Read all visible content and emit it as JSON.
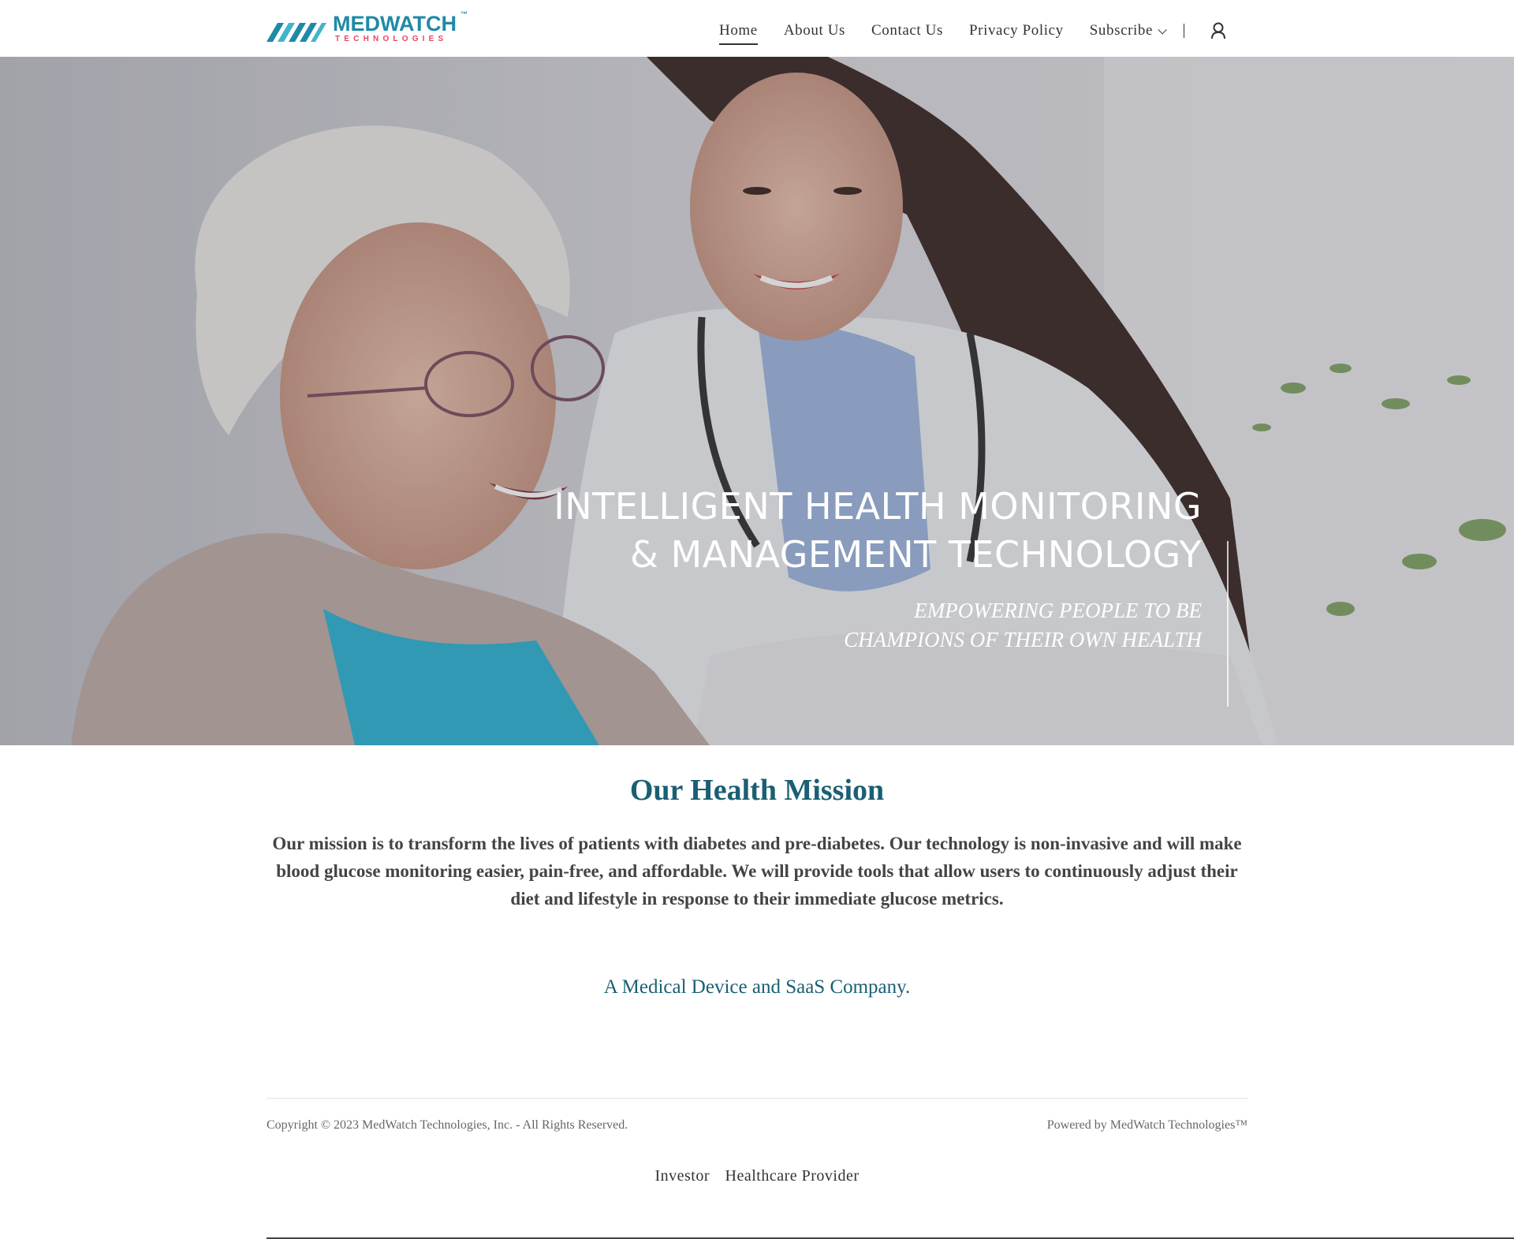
{
  "brand": {
    "name_part1": "MED",
    "name_part2": "WATCH",
    "tm": "™",
    "subtitle": "TECHNOLOGIES",
    "colors": {
      "teal": "#1f8aa6",
      "pink": "#e8475f",
      "heading": "#1a5f73"
    }
  },
  "nav": {
    "items": [
      {
        "label": "Home",
        "active": true
      },
      {
        "label": "About Us",
        "active": false
      },
      {
        "label": "Contact Us",
        "active": false
      },
      {
        "label": "Privacy Policy",
        "active": false
      },
      {
        "label": "Subscribe",
        "active": false,
        "dropdown": true
      }
    ],
    "separator": "|",
    "account_icon": "user-icon"
  },
  "hero": {
    "title_line1": "INTELLIGENT HEALTH MONITORING",
    "title_line2": "& MANAGEMENT TECHNOLOGY",
    "subtitle_line1": "EMPOWERING PEOPLE TO BE",
    "subtitle_line2": "CHAMPIONS OF THEIR OWN HEALTH"
  },
  "mission": {
    "title": "Our Health Mission",
    "body": "Our mission is to transform the lives of patients with diabetes and pre-diabetes. Our technology is non-invasive and will make blood glucose monitoring easier, pain-free, and affordable. We will provide tools that allow users to continuously adjust their diet and lifestyle in response to their immediate glucose metrics.",
    "tagline": "A Medical Device and SaaS Company."
  },
  "footer": {
    "copyright": "Copyright © 2023 MedWatch Technologies, Inc. - All Rights Reserved.",
    "powered_by": "Powered by MedWatch Technologies™",
    "links": [
      "Investor",
      "Healthcare Provider"
    ]
  }
}
